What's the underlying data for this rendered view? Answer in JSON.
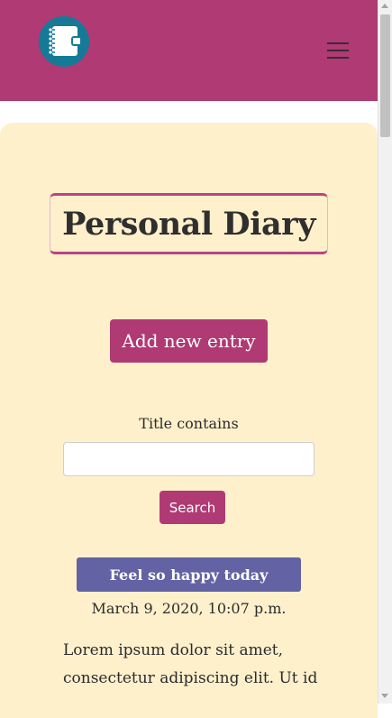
{
  "navbar": {
    "logo_icon": "diary-notebook-icon",
    "menu_icon": "hamburger-menu-icon",
    "brand_color": "#b03a73",
    "logo_color": "#157a95"
  },
  "main": {
    "title": "Personal Diary",
    "add_button_label": "Add new entry",
    "filter": {
      "label": "Title contains",
      "value": "",
      "placeholder": ""
    },
    "search_button_label": "Search",
    "entries": [
      {
        "title": "Feel so happy today",
        "date": "March 9, 2020, 10:07 p.m.",
        "text": "Lorem ipsum dolor sit amet, consectetur adipiscing elit. Ut id"
      }
    ]
  },
  "colors": {
    "card_background": "#fff0cc",
    "entry_title_background": "#6262a4"
  }
}
